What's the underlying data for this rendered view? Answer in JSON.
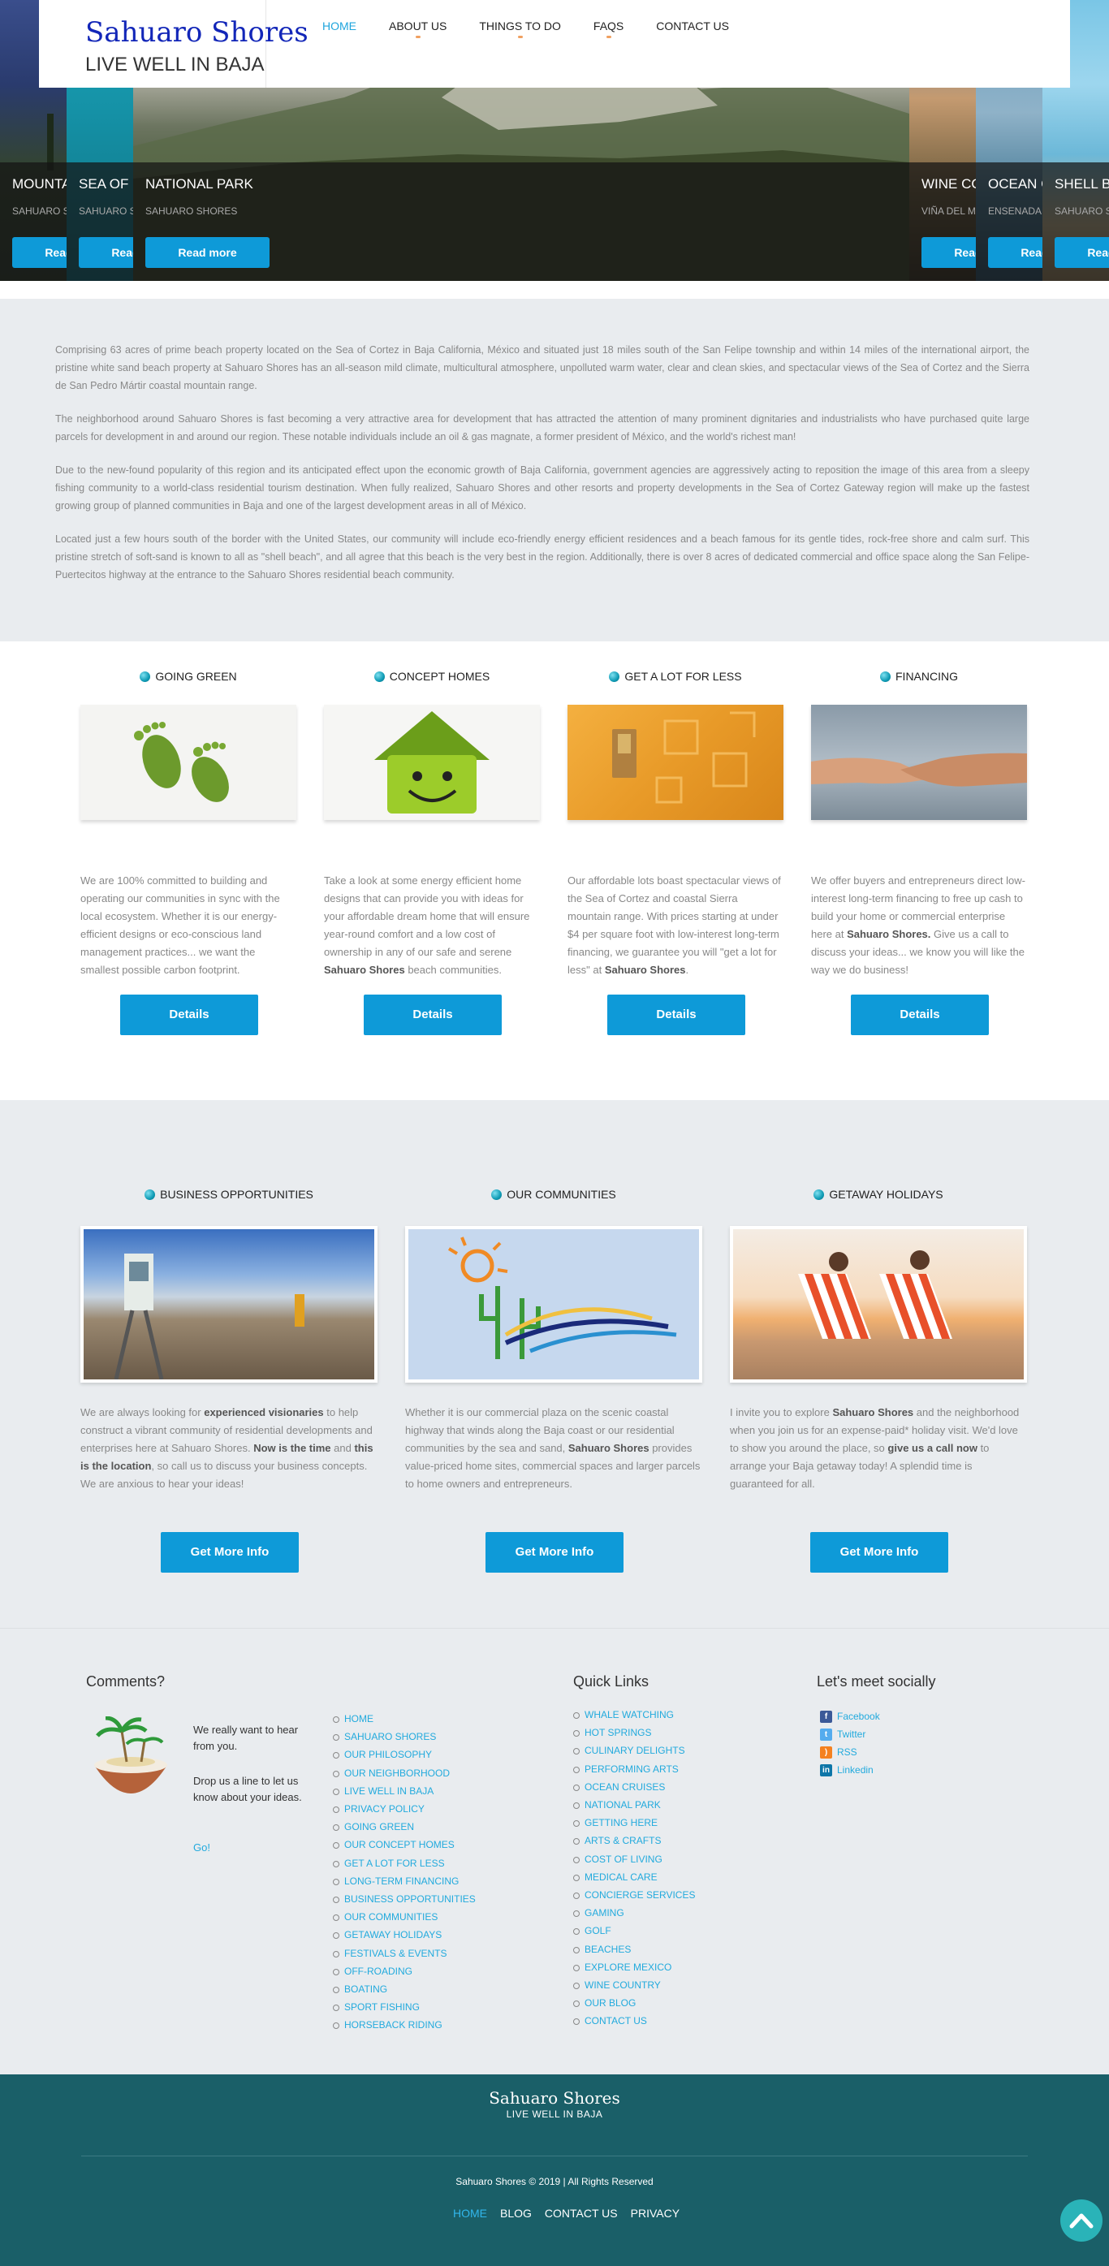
{
  "brand": {
    "name": "Sahuaro Shores",
    "tagline": "LIVE WELL IN BAJA"
  },
  "nav": [
    {
      "label": "HOME",
      "active": true
    },
    {
      "label": "ABOUT US",
      "dot": true
    },
    {
      "label": "THINGS TO DO",
      "dot": true
    },
    {
      "label": "FAQS",
      "dot": true
    },
    {
      "label": "CONTACT US"
    }
  ],
  "slides": [
    {
      "title": "MOUNTAINS",
      "subtitle": "SAHUARO SHORES",
      "button": "Read more"
    },
    {
      "title": "SEA OF CORTEZ",
      "subtitle": "SAHUARO SHORES",
      "button": "Read more"
    },
    {
      "title": "NATIONAL PARK",
      "subtitle": "SAHUARO SHORES",
      "button": "Read more"
    },
    {
      "title": "WINE COUNTRY",
      "subtitle": "VIÑA DEL MAR",
      "button": "Read more"
    },
    {
      "title": "OCEAN CRUISES",
      "subtitle": "ENSENADA",
      "button": "Read more"
    },
    {
      "title": "SHELL BEACH",
      "subtitle": "SAHUARO SHORES",
      "button": "Read more"
    }
  ],
  "intro": [
    "Comprising 63 acres of prime beach property located on the Sea of Cortez in Baja California, México and situated just 18 miles south of the San Felipe township and within 14 miles of the international airport, the pristine white sand beach property at Sahuaro Shores has an all-season mild climate, multicultural atmosphere, unpolluted warm water, clear and clean skies, and spectacular views of the Sea of Cortez and the Sierra de San Pedro Mártir coastal mountain range.",
    "The neighborhood around Sahuaro Shores is fast becoming a very attractive area for development that has attracted the attention of many prominent dignitaries and industrialists who have purchased quite large parcels for development in and around our region. These notable individuals include an oil & gas magnate, a former president of México, and the world's richest man!",
    "Due to the new-found popularity of this region and its anticipated effect upon the economic growth of Baja California, government agencies are aggressively acting to reposition the image of this area from a sleepy fishing community to a world-class residential tourism destination. When fully realized, Sahuaro Shores and other resorts and property developments in the Sea of Cortez Gateway region will make up the fastest growing group of planned communities in Baja and one of the largest development areas in all of México.",
    "Located just a few hours south of the border with the United States, our community will include eco-friendly energy efficient residences and a beach famous for its gentle tides, rock-free shore and calm surf. This pristine stretch of soft-sand is known to all as \"shell beach\", and all agree that this beach is the very best in the region. Additionally, there is over 8 acres of dedicated commercial and office space along the San Felipe-Puertecitos highway at the entrance to the Sahuaro Shores residential beach community."
  ],
  "features": [
    {
      "title": "GOING GREEN",
      "image": "green-footprints",
      "button": "Details",
      "text": "We are 100% committed to building and operating our communities in sync with the local ecosystem. Whether it is our energy-efficient designs or eco-conscious land management practices... we want the smallest possible carbon footprint."
    },
    {
      "title": "CONCEPT HOMES",
      "image": "smiling-green-house",
      "button": "Details",
      "text_a": "Take a look at some energy efficient home designs that can provide you with ideas for your affordable dream home that will ensure year-round comfort and a low cost of ownership in any of our safe and serene ",
      "text_b": "Sahuaro Shores",
      "text_c": " beach communities."
    },
    {
      "title": "GET A LOT FOR LESS",
      "image": "coin-in-slot",
      "button": "Details",
      "text_a": "Our affordable lots boast spectacular views of the Sea of Cortez and coastal Sierra mountain range. With prices starting at under $4 per square foot with low-interest long-term financing, we guarantee you will \"get a lot for less\" at ",
      "text_b": "Sahuaro Shores",
      "text_c": "."
    },
    {
      "title": "FINANCING",
      "image": "handshake",
      "button": "Details",
      "text_a": "We offer buyers and entrepreneurs direct low-interest long-term financing to free up cash  to build your home or commercial enterprise here at ",
      "text_b": "Sahuaro Shores.",
      "text_c": " Give us a call to discuss your ideas... we know you will like the way we do business!"
    }
  ],
  "opportunities": [
    {
      "title": "BUSINESS OPPORTUNITIES",
      "image": "survey-equipment",
      "button": "Get More Info",
      "t1": "We are always looking for ",
      "b1": "experienced visionaries",
      "t2": " to help construct a vibrant community of residential developments and enterprises here at Sahuaro Shores. ",
      "b2": "Now is the time",
      "t3": " and ",
      "b3": "this is the location",
      "t4": ", so call us to discuss your business concepts. We are anxious to hear your ideas!"
    },
    {
      "title": "OUR COMMUNITIES",
      "image": "cactus-logo-art",
      "button": "Get More Info",
      "t1": "Whether it is our commercial plaza on the scenic coastal highway that winds along the Baja coast or our residential communities by the sea and sand, ",
      "b1": "Sahuaro Shores",
      "t2": " provides value-priced home sites, commercial spaces and larger parcels to home owners and entrepreneurs."
    },
    {
      "title": "GETAWAY HOLIDAYS",
      "image": "beach-chairs-sunset",
      "button": "Get More Info",
      "t1": "I invite you to explore ",
      "b1": "Sahuaro Shores",
      "t2": " and the neighborhood when you join us for an expense-paid* holiday visit.  We'd love to show you around the place, so ",
      "b2": "give us a call now",
      "t3": " to arrange your Baja getaway today!  A splendid time is guaranteed for all."
    }
  ],
  "footer": {
    "comments_heading": "Comments?",
    "comments_text1": "We really want to hear from you.",
    "comments_text2": "Drop us a line to let us know about your ideas.",
    "comments_go": "Go!",
    "site_links": [
      "HOME",
      "SAHUARO SHORES",
      "OUR PHILOSOPHY",
      "OUR NEIGHBORHOOD",
      "LIVE WELL IN BAJA",
      "PRIVACY POLICY",
      "GOING GREEN",
      "OUR CONCEPT HOMES",
      "GET A LOT FOR LESS",
      "LONG-TERM FINANCING",
      "BUSINESS OPPORTUNITIES",
      "OUR COMMUNITIES",
      "GETAWAY HOLIDAYS",
      "FESTIVALS & EVENTS",
      "OFF-ROADING",
      "BOATING",
      "SPORT FISHING",
      "HORSEBACK RIDING"
    ],
    "quick_heading": "Quick Links",
    "quick_links": [
      "WHALE WATCHING",
      "HOT SPRINGS",
      "CULINARY DELIGHTS",
      "PERFORMING ARTS",
      "OCEAN CRUISES",
      "NATIONAL PARK",
      "GETTING HERE",
      "ARTS & CRAFTS",
      "COST OF LIVING",
      "MEDICAL CARE",
      "CONCIERGE SERVICES",
      "GAMING",
      "GOLF",
      "BEACHES",
      "EXPLORE MEXICO",
      "WINE COUNTRY",
      "OUR BLOG",
      "CONTACT US"
    ],
    "social_heading": "Let's meet socially",
    "social": [
      {
        "label": "Facebook",
        "icon": "facebook-icon",
        "color": "#3b5998",
        "glyph": "f"
      },
      {
        "label": "Twitter",
        "icon": "twitter-icon",
        "color": "#55acee",
        "glyph": "t"
      },
      {
        "label": "RSS",
        "icon": "rss-icon",
        "color": "#f48120",
        "glyph": ")"
      },
      {
        "label": "Linkedin",
        "icon": "linkedin-icon",
        "color": "#0e76a8",
        "glyph": "in"
      }
    ]
  },
  "bottom": {
    "logo_name": "Sahuaro Shores",
    "logo_tagline": "LIVE WELL IN BAJA",
    "copyright": "Sahuaro Shores © 2019 | All Rights Reserved",
    "links": [
      {
        "label": "HOME",
        "active": true
      },
      {
        "label": "BLOG"
      },
      {
        "label": "CONTACT US"
      },
      {
        "label": "PRIVACY"
      }
    ]
  },
  "colors": {
    "accent": "#0e9ad8",
    "link": "#22aadd",
    "footer_bg": "#1a5f68",
    "section_bg": "#e9ecef"
  }
}
